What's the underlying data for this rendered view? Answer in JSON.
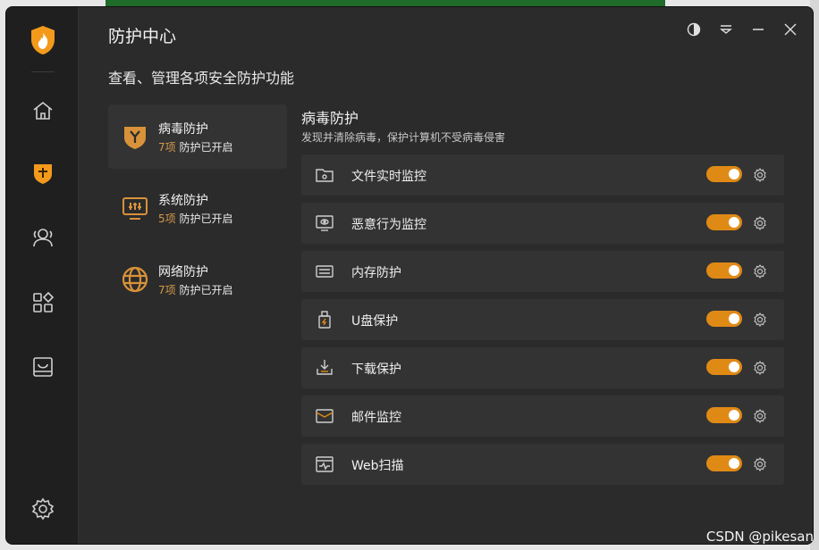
{
  "window": {
    "title": "防护中心",
    "subtitle": "查看、管理各项安全防护功能"
  },
  "rail": {
    "items": [
      {
        "icon": "home-icon"
      },
      {
        "icon": "shield-plus-icon",
        "active": true
      },
      {
        "icon": "users-icon"
      },
      {
        "icon": "apps-icon"
      },
      {
        "icon": "box-icon"
      }
    ],
    "settings_icon": "gear-icon"
  },
  "categories": [
    {
      "name": "病毒防护",
      "count": "7项",
      "status": "防护已开启",
      "icon": "virus-shield-icon",
      "active": true
    },
    {
      "name": "系统防护",
      "count": "5项",
      "status": "防护已开启",
      "icon": "system-monitor-icon"
    },
    {
      "name": "网络防护",
      "count": "7项",
      "status": "防护已开启",
      "icon": "globe-icon"
    }
  ],
  "section": {
    "title": "病毒防护",
    "description": "发现并清除病毒，保护计算机不受病毒侵害"
  },
  "features": [
    {
      "label": "文件实时监控",
      "icon": "folder-icon",
      "enabled": true
    },
    {
      "label": "恶意行为监控",
      "icon": "monitor-eye-icon",
      "enabled": true
    },
    {
      "label": "内存防护",
      "icon": "memory-icon",
      "enabled": true
    },
    {
      "label": "U盘保护",
      "icon": "usb-icon",
      "enabled": true
    },
    {
      "label": "下载保护",
      "icon": "download-icon",
      "enabled": true
    },
    {
      "label": "邮件监控",
      "icon": "mail-icon",
      "enabled": true
    },
    {
      "label": "Web扫描",
      "icon": "web-scan-icon",
      "enabled": true
    }
  ],
  "colors": {
    "accent": "#e08a16",
    "background": "#2b2b2b",
    "rail": "#1f1f1f",
    "card": "#333333"
  },
  "watermark": "CSDN @pikesan"
}
